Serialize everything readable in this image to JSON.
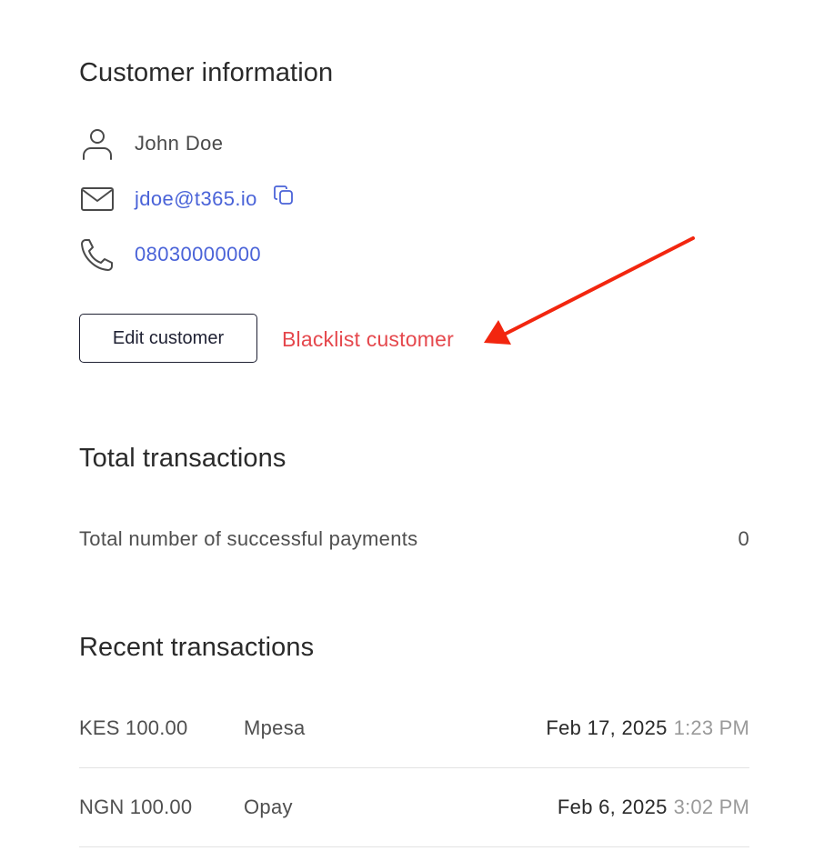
{
  "customer_info": {
    "title": "Customer information",
    "name": "John Doe",
    "email": "jdoe@t365.io",
    "phone": "08030000000",
    "icons": {
      "name": "user-icon",
      "email": "mail-icon",
      "phone": "phone-icon",
      "copy": "copy-icon"
    },
    "edit_label": "Edit customer",
    "blacklist_label": "Blacklist customer"
  },
  "total_transactions": {
    "title": "Total transactions",
    "label": "Total number of successful payments",
    "value": "0"
  },
  "recent_transactions": {
    "title": "Recent transactions",
    "rows": [
      {
        "amount": "KES 100.00",
        "method": "Mpesa",
        "date": "Feb 17, 2025",
        "time": "1:23 PM"
      },
      {
        "amount": "NGN 100.00",
        "method": "Opay",
        "date": "Feb 6, 2025",
        "time": "3:02 PM"
      }
    ]
  },
  "colors": {
    "link": "#4a63d8",
    "danger": "#e5484d",
    "annotation_arrow": "#f2260f",
    "muted": "#9a9a9a",
    "divider": "#e3e3e3"
  }
}
